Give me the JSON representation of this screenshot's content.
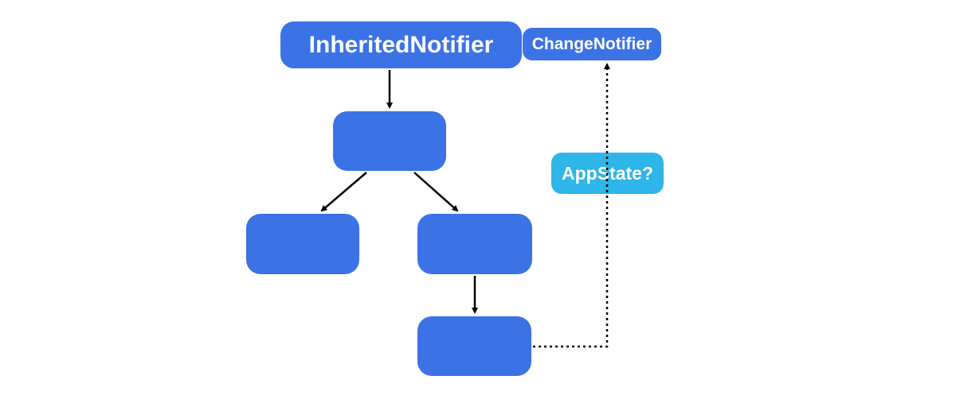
{
  "nodes": {
    "inherited_notifier": {
      "label": "InheritedNotifier"
    },
    "change_notifier": {
      "label": "ChangeNotifier"
    },
    "app_state": {
      "label": "AppState?"
    },
    "widget_a": {
      "label": ""
    },
    "widget_b": {
      "label": ""
    },
    "widget_c": {
      "label": ""
    },
    "widget_d": {
      "label": ""
    }
  },
  "colors": {
    "primary": "#3b72e6",
    "accent": "#2eb5e9",
    "arrow": "#000000"
  },
  "edges": [
    {
      "from": "inherited_notifier",
      "to": "widget_a",
      "style": "solid"
    },
    {
      "from": "widget_a",
      "to": "widget_b",
      "style": "solid"
    },
    {
      "from": "widget_a",
      "to": "widget_c",
      "style": "solid"
    },
    {
      "from": "widget_c",
      "to": "widget_d",
      "style": "solid"
    },
    {
      "from": "widget_d",
      "to": "change_notifier",
      "style": "dotted"
    }
  ]
}
